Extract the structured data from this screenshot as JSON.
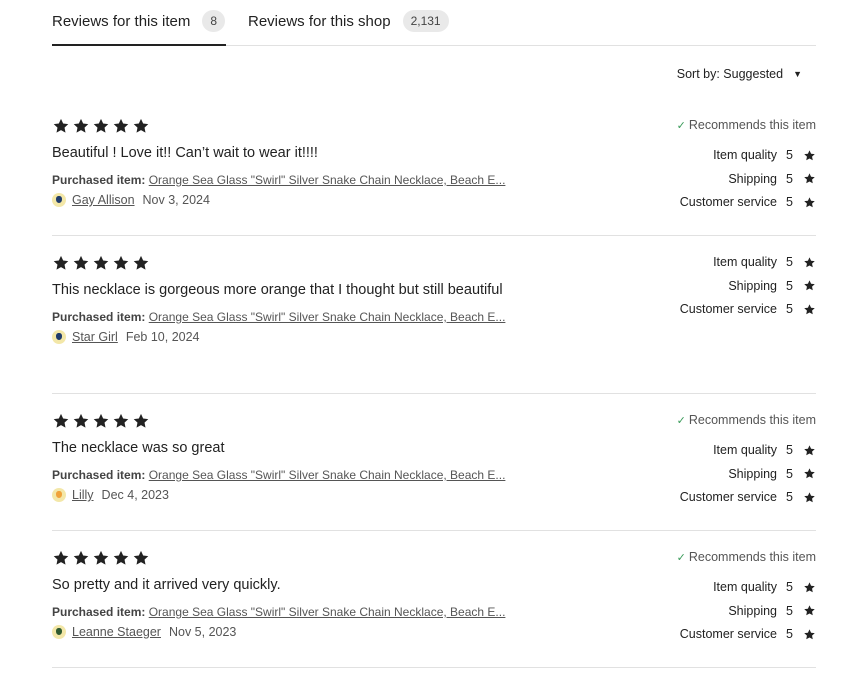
{
  "tabs": [
    {
      "label": "Reviews for this item",
      "count": "8"
    },
    {
      "label": "Reviews for this shop",
      "count": "2,131"
    }
  ],
  "sort": {
    "label": "Sort by: Suggested"
  },
  "colors": {
    "star": "#222222",
    "check": "#3a9b5a",
    "divider": "#e1e1e1"
  },
  "purchased_label": "Purchased item:",
  "rating_labels": {
    "item_quality": "Item quality",
    "shipping": "Shipping",
    "customer_service": "Customer service"
  },
  "reviews": [
    {
      "stars": 5,
      "recommends": "Recommends this item",
      "text": "Beautiful ! Love it!! Can’t wait to wear it!!!!",
      "purchased_item": "Orange Sea Glass \"Swirl\" Silver Snake Chain Necklace, Beach E...",
      "author": "Gay Allison",
      "date": "Nov 3, 2024",
      "item_quality": "5",
      "shipping": "5",
      "customer_service": "5"
    },
    {
      "stars": 5,
      "recommends": "",
      "text": "This necklace is gorgeous more orange that I thought but still beautiful",
      "purchased_item": "Orange Sea Glass \"Swirl\" Silver Snake Chain Necklace, Beach E...",
      "author": "Star Girl",
      "date": "Feb 10, 2024",
      "item_quality": "5",
      "shipping": "5",
      "customer_service": "5"
    },
    {
      "stars": 5,
      "recommends": "Recommends this item",
      "text": "The necklace was so great",
      "purchased_item": "Orange Sea Glass \"Swirl\" Silver Snake Chain Necklace, Beach E...",
      "author": "Lilly",
      "date": "Dec 4, 2023",
      "item_quality": "5",
      "shipping": "5",
      "customer_service": "5"
    },
    {
      "stars": 5,
      "recommends": "Recommends this item",
      "text": "So pretty and it arrived very quickly.",
      "purchased_item": "Orange Sea Glass \"Swirl\" Silver Snake Chain Necklace, Beach E...",
      "author": "Leanne Staeger",
      "date": "Nov 5, 2023",
      "item_quality": "5",
      "shipping": "5",
      "customer_service": "5"
    }
  ]
}
